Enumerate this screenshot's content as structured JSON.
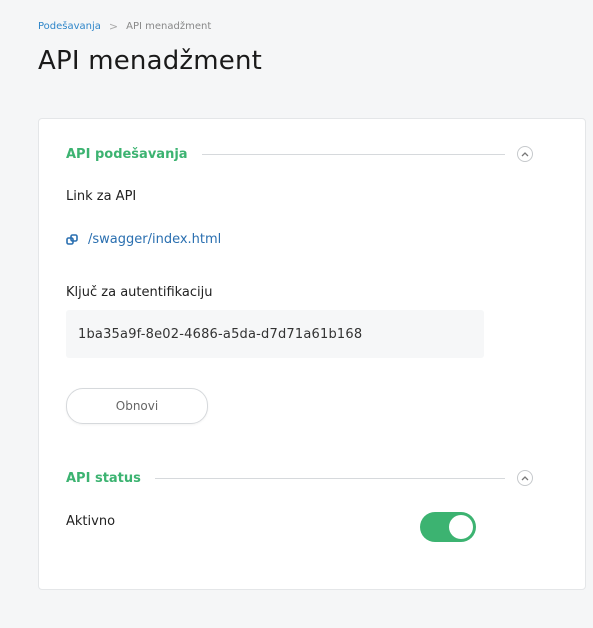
{
  "breadcrumb": {
    "parent": "Podešavanja",
    "separator": ">",
    "current": "API menadžment"
  },
  "page_title": "API menadžment",
  "sections": [
    {
      "title": "API podešavanja",
      "collapse_icon": "chevron-up-icon",
      "link_label": "Link za API",
      "link_icon": "link-icon",
      "link_text": "/swagger/index.html",
      "key_label": "Ključ za autentifikaciju",
      "key_value": "1ba35a9f-8e02-4686-a5da-d7d71a61b168",
      "refresh_button": "Obnovi"
    },
    {
      "title": "API status",
      "collapse_icon": "chevron-up-icon",
      "status_label": "Aktivno",
      "status_enabled": true
    }
  ],
  "colors": {
    "accent": "#3cb371",
    "link": "#2a6fb0",
    "breadcrumb_link": "#2f86c9"
  }
}
